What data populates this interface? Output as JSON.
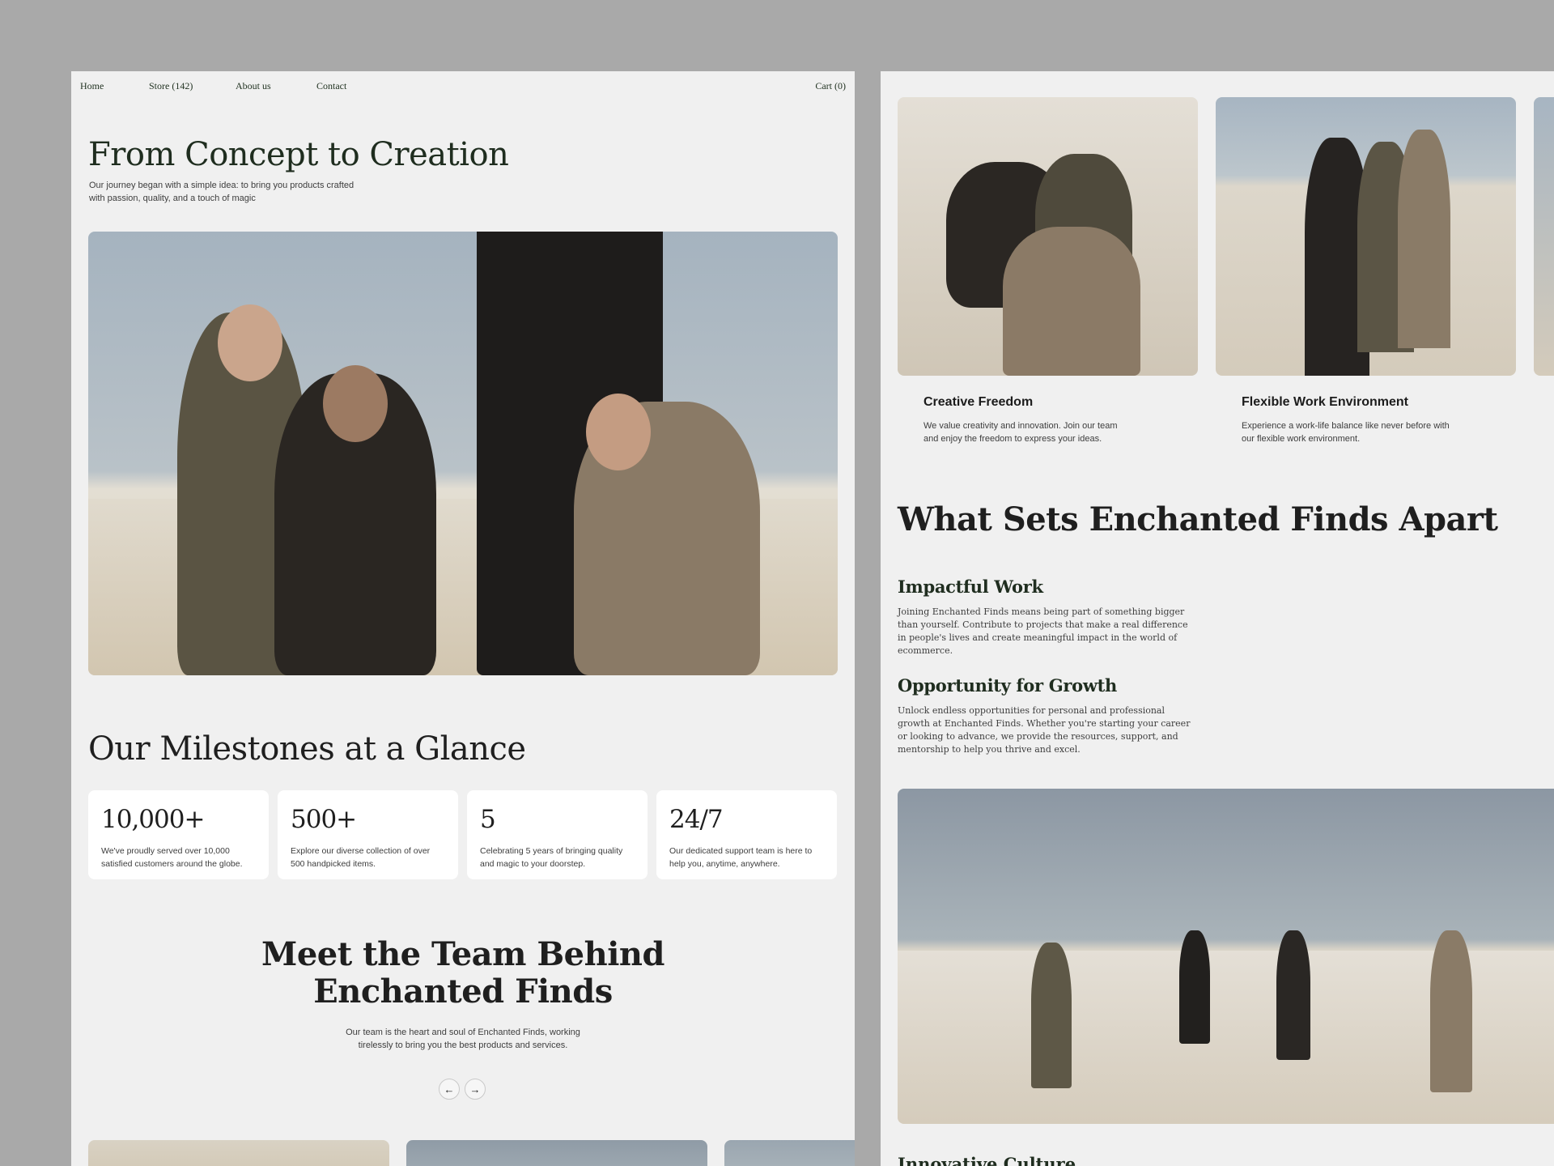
{
  "nav": {
    "home": "Home",
    "store": "Store (142)",
    "about": "About us",
    "contact": "Contact",
    "cart": "Cart (0)"
  },
  "hero": {
    "title": "From Concept to Creation",
    "subtitle": "Our journey began with a simple idea: to bring you products crafted with passion, quality, and a touch of magic"
  },
  "milestones": {
    "title": "Our Milestones at a Glance",
    "stats": [
      {
        "value": "10,000+",
        "desc": "We've proudly served over 10,000 satisfied customers around the globe."
      },
      {
        "value": "500+",
        "desc": "Explore our diverse collection of over 500 handpicked items."
      },
      {
        "value": "5",
        "desc": "Celebrating 5 years of bringing quality and magic to your doorstep."
      },
      {
        "value": "24/7",
        "desc": "Our dedicated support team is here to help you, anytime, anywhere."
      }
    ]
  },
  "team": {
    "title_line1": "Meet the Team Behind",
    "title_line2": "Enchanted Finds",
    "subtitle": "Our team is the heart and soul of Enchanted Finds, working tirelessly to bring you the best products and services.",
    "prev_icon": "←",
    "next_icon": "→"
  },
  "benefits": [
    {
      "title": "Creative Freedom",
      "desc": "We value creativity and innovation. Join our team and enjoy the freedom to express your ideas."
    },
    {
      "title": "Flexible Work Environment",
      "desc": "Experience a work-life balance like never before with our flexible work environment."
    }
  ],
  "apart": {
    "title": "What Sets Enchanted Finds Apart",
    "items": [
      {
        "title": "Impactful Work",
        "desc": "Joining Enchanted Finds means being part of something bigger than yourself. Contribute to projects that make a real difference in people's lives and create meaningful impact in the world of ecommerce."
      },
      {
        "title": "Opportunity for Growth",
        "desc": "Unlock endless opportunities for personal and professional growth at Enchanted Finds. Whether you're starting your career or looking to advance, we provide the resources, support, and mentorship to help you thrive and excel."
      }
    ],
    "next_heading": "Innovative Culture"
  },
  "colors": {
    "page_bg": "#a9a9a9",
    "panel_bg": "#f0f0f0",
    "card_bg": "#ffffff",
    "heading_green": "#1f2d1f"
  }
}
